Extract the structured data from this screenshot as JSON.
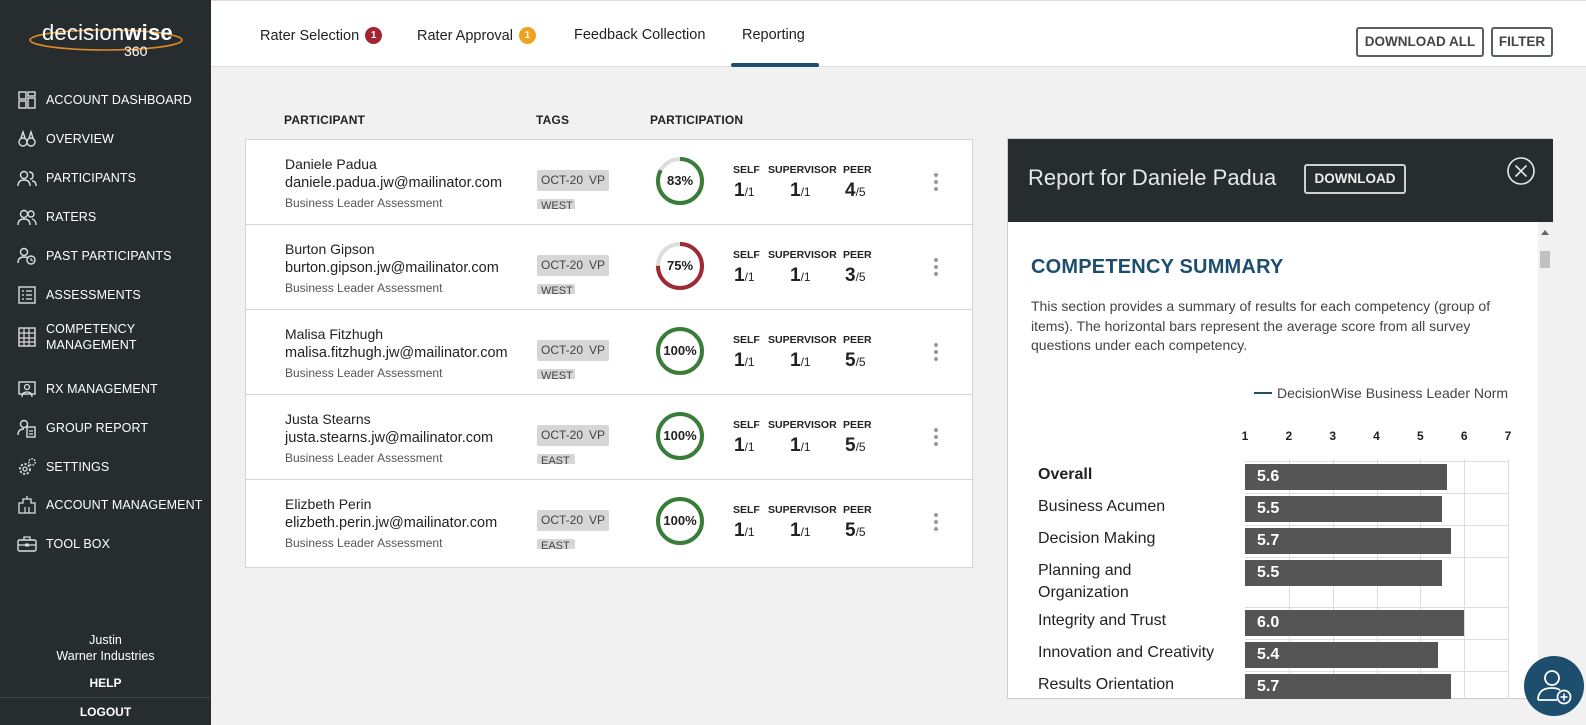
{
  "logo": {
    "word1": "decision",
    "word2": "wise",
    "sub": "360"
  },
  "nav": [
    {
      "label": "ACCOUNT DASHBOARD",
      "icon": "dashboard-icon"
    },
    {
      "label": "OVERVIEW",
      "icon": "binoculars-icon"
    },
    {
      "label": "PARTICIPANTS",
      "icon": "users-icon"
    },
    {
      "label": "RATERS",
      "icon": "raters-icon"
    },
    {
      "label": "PAST PARTICIPANTS",
      "icon": "past-users-icon"
    },
    {
      "label": "COMPETENCY MANAGEMENT",
      "icon": "competency-icon"
    },
    {
      "label": "RX MANAGEMENT",
      "icon": "rx-icon"
    },
    {
      "label": "GROUP REPORT",
      "icon": "group-report-icon"
    },
    {
      "label": "SETTINGS",
      "icon": "gear-icon"
    },
    {
      "label": "ACCOUNT MANAGEMENT",
      "icon": "building-icon"
    },
    {
      "label": "TOOL BOX",
      "icon": "toolbox-icon"
    }
  ],
  "user": {
    "name": "Justin",
    "company": "Warner Industries"
  },
  "help": "HELP",
  "logout": "LOGOUT",
  "tabs": [
    {
      "label": "Rater Selection",
      "badge": "1",
      "badge_color": "#a32234"
    },
    {
      "label": "Rater Approval",
      "badge": "1",
      "badge_color": "#f0a21e"
    },
    {
      "label": "Feedback Collection",
      "badge": "",
      "badge_color": ""
    },
    {
      "label": "Reporting",
      "badge": "",
      "badge_color": ""
    }
  ],
  "active_tab": "Reporting",
  "toolbar": {
    "download_all": "DOWNLOAD ALL",
    "filter": "FILTER"
  },
  "table": {
    "headers": {
      "participant": "PARTICIPANT",
      "tags": "TAGS",
      "participation": "PARTICIPATION"
    },
    "count_labels": {
      "self": "SELF",
      "supervisor": "SUPERVISOR",
      "peer": "PEER"
    },
    "rows": [
      {
        "name": "Daniele Padua",
        "email": "daniele.padua.jw@mailinator.com",
        "assessment": "Business Leader Assessment",
        "tags": [
          "OCT-20",
          "VP",
          "WEST"
        ],
        "percent": "83%",
        "fraction": 0.83,
        "ring_color": "#3a7d3a",
        "self": "1",
        "self_total": "/1",
        "supervisor": "1",
        "supervisor_total": "/1",
        "peer": "4",
        "peer_total": "/5"
      },
      {
        "name": "Burton Gipson",
        "email": "burton.gipson.jw@mailinator.com",
        "assessment": "Business Leader Assessment",
        "tags": [
          "OCT-20",
          "VP",
          "WEST"
        ],
        "percent": "75%",
        "fraction": 0.75,
        "ring_color": "#9e2a35",
        "self": "1",
        "self_total": "/1",
        "supervisor": "1",
        "supervisor_total": "/1",
        "peer": "3",
        "peer_total": "/5"
      },
      {
        "name": "Malisa Fitzhugh",
        "email": "malisa.fitzhugh.jw@mailinator.com",
        "assessment": "Business Leader Assessment",
        "tags": [
          "OCT-20",
          "VP",
          "WEST"
        ],
        "percent": "100%",
        "fraction": 1.0,
        "ring_color": "#3a7d3a",
        "self": "1",
        "self_total": "/1",
        "supervisor": "1",
        "supervisor_total": "/1",
        "peer": "5",
        "peer_total": "/5"
      },
      {
        "name": "Justa Stearns",
        "email": "justa.stearns.jw@mailinator.com",
        "assessment": "Business Leader Assessment",
        "tags": [
          "OCT-20",
          "VP",
          "EAST"
        ],
        "percent": "100%",
        "fraction": 1.0,
        "ring_color": "#3a7d3a",
        "self": "1",
        "self_total": "/1",
        "supervisor": "1",
        "supervisor_total": "/1",
        "peer": "5",
        "peer_total": "/5"
      },
      {
        "name": "Elizbeth Perin",
        "email": "elizbeth.perin.jw@mailinator.com",
        "assessment": "Business Leader Assessment",
        "tags": [
          "OCT-20",
          "VP",
          "EAST"
        ],
        "percent": "100%",
        "fraction": 1.0,
        "ring_color": "#3a7d3a",
        "self": "1",
        "self_total": "/1",
        "supervisor": "1",
        "supervisor_total": "/1",
        "peer": "5",
        "peer_total": "/5"
      }
    ]
  },
  "report": {
    "title": "Report for Daniele Padua",
    "download": "DOWNLOAD",
    "section_title": "COMPETENCY SUMMARY",
    "description": "This section provides a summary of results for each competency (group of items). The horizontal bars represent the average score from all survey questions under each competency.",
    "legend": "DecisionWise Business Leader Norm"
  },
  "chart_data": {
    "type": "bar",
    "orientation": "horizontal",
    "xlim": [
      1,
      7
    ],
    "ticks": [
      "1",
      "2",
      "3",
      "4",
      "5",
      "6",
      "7"
    ],
    "categories": [
      "Overall",
      "Business Acumen",
      "Decision Making",
      "Planning and Organization",
      "Integrity and Trust",
      "Innovation and Creativity",
      "Results Orientation"
    ],
    "values": [
      5.6,
      5.5,
      5.7,
      5.5,
      6.0,
      5.4,
      5.7
    ],
    "labels": [
      "5.6",
      "5.5",
      "5.7",
      "5.5",
      "6.0",
      "5.4",
      "5.7"
    ],
    "bar_color": "#555555"
  },
  "colors": {
    "sidebar": "#272c2e",
    "accent": "#1d4e6e"
  }
}
